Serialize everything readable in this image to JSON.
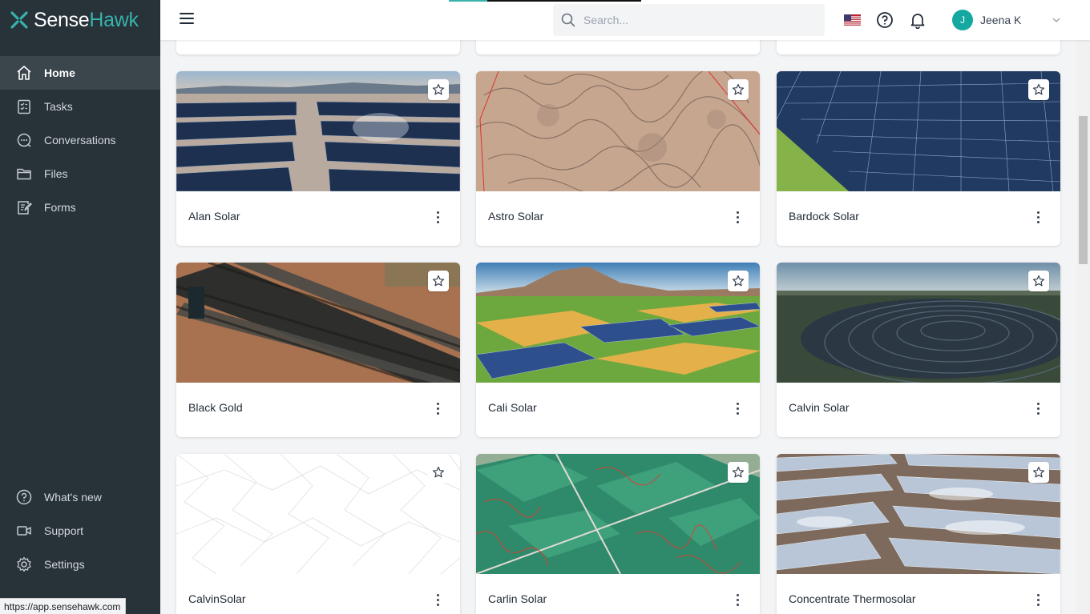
{
  "app": {
    "logo_sense": "Sense",
    "logo_hawk": "Hawk",
    "brand_color": "#38b2ac",
    "sidebar_bg": "#273239"
  },
  "sidebar": {
    "items": [
      {
        "label": "Home",
        "icon": "home-icon",
        "active": true
      },
      {
        "label": "Tasks",
        "icon": "tasks-icon"
      },
      {
        "label": "Conversations",
        "icon": "chat-icon"
      },
      {
        "label": "Files",
        "icon": "folder-icon"
      },
      {
        "label": "Forms",
        "icon": "forms-icon"
      }
    ],
    "bottom_items": [
      {
        "label": "What's new",
        "icon": "help-circle-icon"
      },
      {
        "label": "Support",
        "icon": "video-icon"
      },
      {
        "label": "Settings",
        "icon": "gear-icon"
      }
    ]
  },
  "status_url": "https://app.sensehawk.com",
  "header": {
    "search_placeholder": "Search...",
    "user_initial": "J",
    "user_name": "Jeena K",
    "flag_icon": "us-flag-icon"
  },
  "cards": [
    {
      "title": "Alan Solar",
      "image": "solar-rows-desert"
    },
    {
      "title": "Astro Solar",
      "image": "aerial-terrain"
    },
    {
      "title": "Bardock Solar",
      "image": "solar-panels-grass"
    },
    {
      "title": "Black Gold",
      "image": "aerial-dark-rows"
    },
    {
      "title": "Cali Solar",
      "image": "valley-solar-farm"
    },
    {
      "title": "Calvin Solar",
      "image": "solar-field-dusk"
    },
    {
      "title": "CalvinSolar",
      "image": "placeholder-pattern"
    },
    {
      "title": "Carlin Solar",
      "image": "green-fields-aerial"
    },
    {
      "title": "Concentrate Thermosolar",
      "image": "parabolic-troughs"
    }
  ]
}
